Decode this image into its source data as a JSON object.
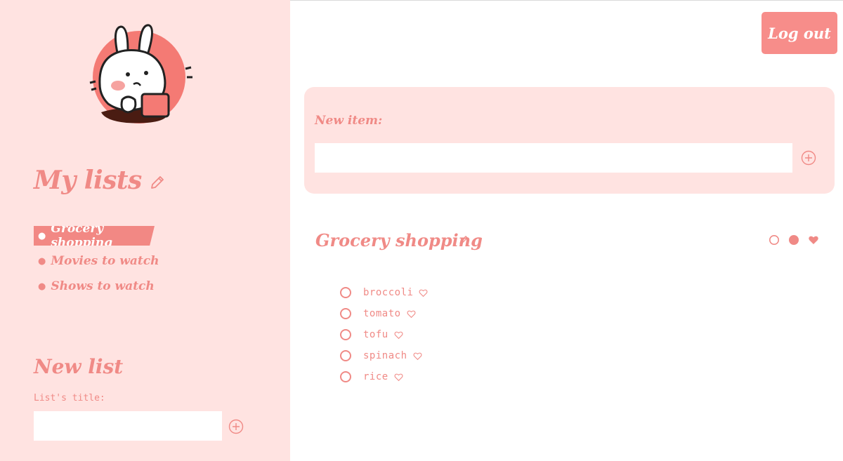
{
  "sidebar": {
    "title": "My lists",
    "lists": [
      {
        "label": "Grocery shopping",
        "active": true
      },
      {
        "label": "Movies to watch",
        "active": false
      },
      {
        "label": "Shows to watch",
        "active": false
      }
    ],
    "new_list": {
      "title": "New list",
      "field_label": "List's title:",
      "value": "",
      "placeholder": ""
    }
  },
  "header": {
    "logout_label": "Log out"
  },
  "new_item": {
    "label": "New item:",
    "value": "",
    "placeholder": ""
  },
  "current_list": {
    "title": "Grocery shopping",
    "items": [
      {
        "label": "broccoli"
      },
      {
        "label": "tomato"
      },
      {
        "label": "tofu"
      },
      {
        "label": "spinach"
      },
      {
        "label": "rice"
      }
    ]
  },
  "colors": {
    "accent": "#f28884",
    "panel": "#ffe3e1",
    "text": "#f08a86"
  },
  "icons": [
    "bunny-avatar",
    "pencil-icon",
    "plus-circle-icon",
    "circle-outline-icon",
    "circle-filled-icon",
    "heart-icon"
  ]
}
